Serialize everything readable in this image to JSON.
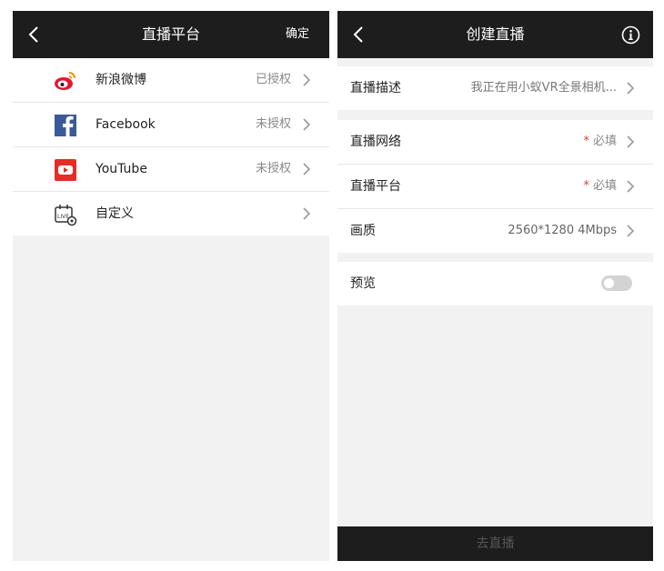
{
  "left": {
    "title": "直播平台",
    "confirm_label": "确定",
    "items": [
      {
        "label": "新浪微博",
        "status": "已授权",
        "icon": "weibo-icon"
      },
      {
        "label": "Facebook",
        "status": "未授权",
        "icon": "facebook-icon"
      },
      {
        "label": "YouTube",
        "status": "未授权",
        "icon": "youtube-icon"
      },
      {
        "label": "自定义",
        "status": "",
        "icon": "live-custom-icon"
      }
    ]
  },
  "right": {
    "title": "创建直播",
    "description": {
      "label": "直播描述",
      "value": "我正在用小蚁VR全景相机..."
    },
    "network": {
      "label": "直播网络",
      "required_mark": "*",
      "value": "必填"
    },
    "platform": {
      "label": "直播平台",
      "required_mark": "*",
      "value": "必填"
    },
    "quality": {
      "label": "画质",
      "value": "2560*1280 4Mbps"
    },
    "preview": {
      "label": "预览",
      "enabled": false
    },
    "go_live_label": "去直播"
  },
  "colors": {
    "topbar": "#1d1d1d",
    "background": "#f2f2f2",
    "required": "#d83a3a",
    "weibo": "#e6162d",
    "facebook": "#3b5998",
    "youtube": "#e52d27"
  }
}
